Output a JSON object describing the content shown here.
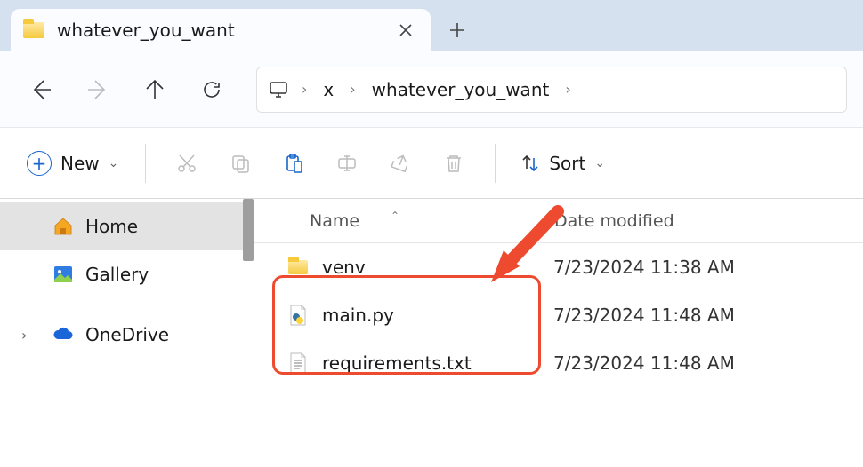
{
  "tab": {
    "title": "whatever_you_want"
  },
  "breadcrumb": {
    "segments": [
      "x",
      "whatever_you_want"
    ]
  },
  "toolbar": {
    "new_label": "New",
    "sort_label": "Sort"
  },
  "sidebar": {
    "items": [
      {
        "label": "Home"
      },
      {
        "label": "Gallery"
      },
      {
        "label": "OneDrive"
      }
    ]
  },
  "columns": {
    "name": "Name",
    "date": "Date modified"
  },
  "files": [
    {
      "name": "venv",
      "date": "7/23/2024 11:38 AM"
    },
    {
      "name": "main.py",
      "date": "7/23/2024 11:48 AM"
    },
    {
      "name": "requirements.txt",
      "date": "7/23/2024 11:48 AM"
    }
  ]
}
